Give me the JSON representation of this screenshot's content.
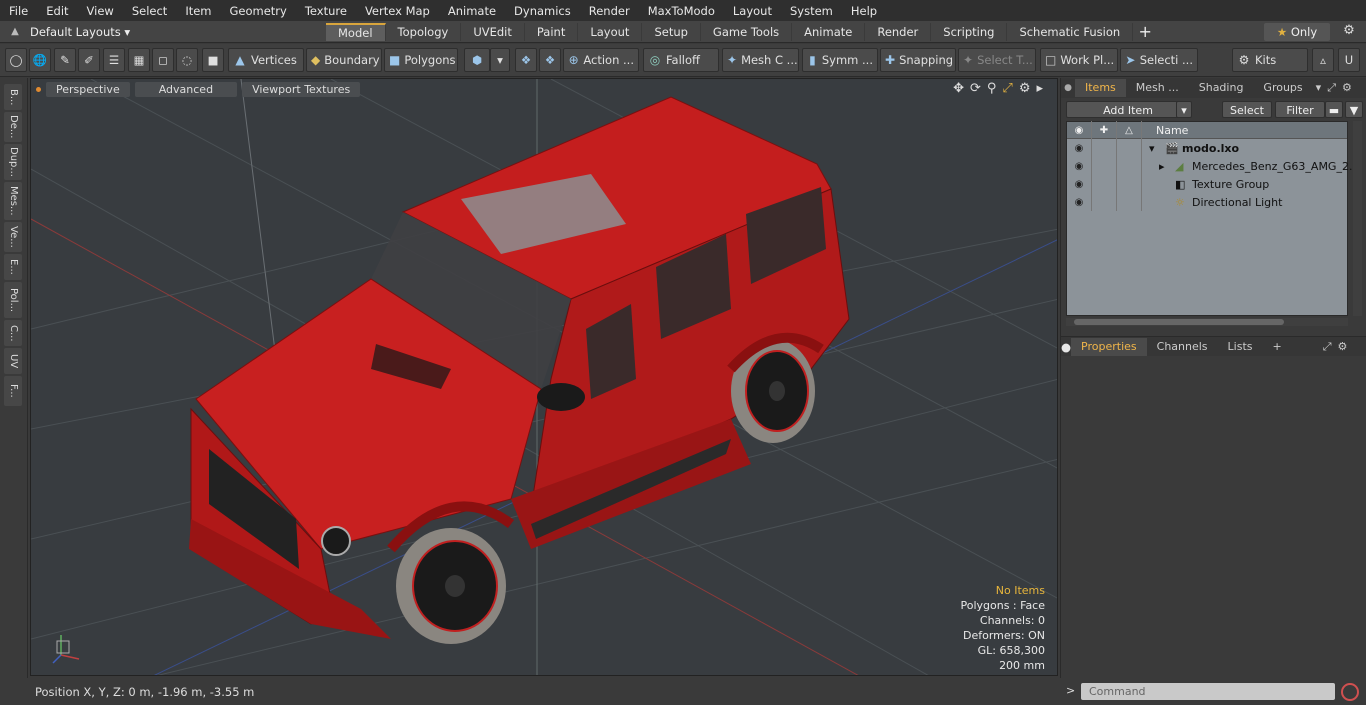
{
  "menu": [
    "File",
    "Edit",
    "View",
    "Select",
    "Item",
    "Geometry",
    "Texture",
    "Vertex Map",
    "Animate",
    "Dynamics",
    "Render",
    "MaxToModo",
    "Layout",
    "System",
    "Help"
  ],
  "layoutbar": {
    "layouts_label": "Default Layouts ▾",
    "tabs": [
      "Model",
      "Topology",
      "UVEdit",
      "Paint",
      "Layout",
      "Setup",
      "Game Tools",
      "Animate",
      "Render",
      "Scripting",
      "Schematic Fusion"
    ],
    "active_tab": "Model",
    "only_label": "Only"
  },
  "toolbar": {
    "vertices": "Vertices",
    "boundary": "Boundary",
    "polygons": "Polygons",
    "action": "Action ...",
    "falloff": "Falloff",
    "mesh": "Mesh C ...",
    "symmetry": "Symm ...",
    "snapping": "Snapping",
    "select_t": "Select T...",
    "work_plane": "Work Pl...",
    "selection": "Selecti ...",
    "kits": "Kits"
  },
  "leftstrip": [
    "B...",
    "De...",
    "Dup...",
    "Mes...",
    "Ve...",
    "E...",
    "Pol...",
    "C...",
    "UV",
    "F..."
  ],
  "viewport": {
    "view_mode": "Perspective",
    "shading": "Advanced",
    "textures": "Viewport Textures",
    "info": {
      "selection": "No Items",
      "polygons": "Polygons : Face",
      "channels": "Channels: 0",
      "deformers": "Deformers: ON",
      "gl": "GL: 658,300",
      "scale": "200 mm"
    }
  },
  "status": {
    "position": "Position X, Y, Z:   0 m, -1.96 m, -3.55 m"
  },
  "items_panel": {
    "tabs": [
      "Items",
      "Mesh ...",
      "Shading",
      "Groups"
    ],
    "add_item": "Add Item",
    "select": "Select",
    "filter": "Filter",
    "column_name": "Name",
    "rows": [
      {
        "label": "modo.lxo",
        "bold": true
      },
      {
        "label": "Mercedes_Benz_G63_AMG_2...",
        "bold": false
      },
      {
        "label": "Texture Group",
        "bold": false
      },
      {
        "label": "Directional Light",
        "bold": false
      }
    ]
  },
  "properties_panel": {
    "tabs": [
      "Properties",
      "Channels",
      "Lists"
    ]
  },
  "command": {
    "placeholder": "Command"
  },
  "colors": {
    "accent": "#d9a53c",
    "car_red": "#c91f1f",
    "viewport_bg": "#383c40",
    "item_list_bg": "#8c9399"
  }
}
